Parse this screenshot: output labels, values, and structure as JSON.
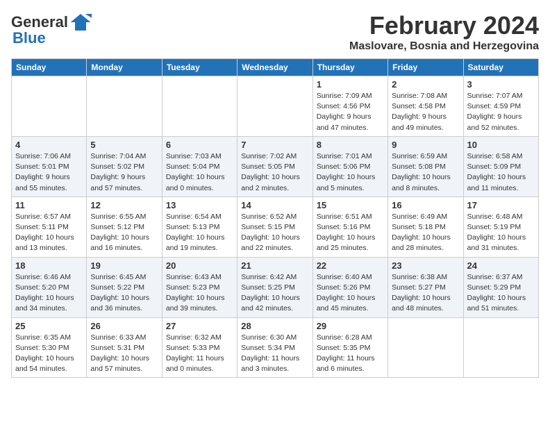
{
  "header": {
    "logo": {
      "general": "General",
      "blue": "Blue"
    },
    "month_title": "February 2024",
    "subtitle": "Maslovare, Bosnia and Herzegovina"
  },
  "days_of_week": [
    "Sunday",
    "Monday",
    "Tuesday",
    "Wednesday",
    "Thursday",
    "Friday",
    "Saturday"
  ],
  "weeks": [
    [
      {
        "day": "",
        "info": ""
      },
      {
        "day": "",
        "info": ""
      },
      {
        "day": "",
        "info": ""
      },
      {
        "day": "",
        "info": ""
      },
      {
        "day": "1",
        "info": "Sunrise: 7:09 AM\nSunset: 4:56 PM\nDaylight: 9 hours\nand 47 minutes."
      },
      {
        "day": "2",
        "info": "Sunrise: 7:08 AM\nSunset: 4:58 PM\nDaylight: 9 hours\nand 49 minutes."
      },
      {
        "day": "3",
        "info": "Sunrise: 7:07 AM\nSunset: 4:59 PM\nDaylight: 9 hours\nand 52 minutes."
      }
    ],
    [
      {
        "day": "4",
        "info": "Sunrise: 7:06 AM\nSunset: 5:01 PM\nDaylight: 9 hours\nand 55 minutes."
      },
      {
        "day": "5",
        "info": "Sunrise: 7:04 AM\nSunset: 5:02 PM\nDaylight: 9 hours\nand 57 minutes."
      },
      {
        "day": "6",
        "info": "Sunrise: 7:03 AM\nSunset: 5:04 PM\nDaylight: 10 hours\nand 0 minutes."
      },
      {
        "day": "7",
        "info": "Sunrise: 7:02 AM\nSunset: 5:05 PM\nDaylight: 10 hours\nand 2 minutes."
      },
      {
        "day": "8",
        "info": "Sunrise: 7:01 AM\nSunset: 5:06 PM\nDaylight: 10 hours\nand 5 minutes."
      },
      {
        "day": "9",
        "info": "Sunrise: 6:59 AM\nSunset: 5:08 PM\nDaylight: 10 hours\nand 8 minutes."
      },
      {
        "day": "10",
        "info": "Sunrise: 6:58 AM\nSunset: 5:09 PM\nDaylight: 10 hours\nand 11 minutes."
      }
    ],
    [
      {
        "day": "11",
        "info": "Sunrise: 6:57 AM\nSunset: 5:11 PM\nDaylight: 10 hours\nand 13 minutes."
      },
      {
        "day": "12",
        "info": "Sunrise: 6:55 AM\nSunset: 5:12 PM\nDaylight: 10 hours\nand 16 minutes."
      },
      {
        "day": "13",
        "info": "Sunrise: 6:54 AM\nSunset: 5:13 PM\nDaylight: 10 hours\nand 19 minutes."
      },
      {
        "day": "14",
        "info": "Sunrise: 6:52 AM\nSunset: 5:15 PM\nDaylight: 10 hours\nand 22 minutes."
      },
      {
        "day": "15",
        "info": "Sunrise: 6:51 AM\nSunset: 5:16 PM\nDaylight: 10 hours\nand 25 minutes."
      },
      {
        "day": "16",
        "info": "Sunrise: 6:49 AM\nSunset: 5:18 PM\nDaylight: 10 hours\nand 28 minutes."
      },
      {
        "day": "17",
        "info": "Sunrise: 6:48 AM\nSunset: 5:19 PM\nDaylight: 10 hours\nand 31 minutes."
      }
    ],
    [
      {
        "day": "18",
        "info": "Sunrise: 6:46 AM\nSunset: 5:20 PM\nDaylight: 10 hours\nand 34 minutes."
      },
      {
        "day": "19",
        "info": "Sunrise: 6:45 AM\nSunset: 5:22 PM\nDaylight: 10 hours\nand 36 minutes."
      },
      {
        "day": "20",
        "info": "Sunrise: 6:43 AM\nSunset: 5:23 PM\nDaylight: 10 hours\nand 39 minutes."
      },
      {
        "day": "21",
        "info": "Sunrise: 6:42 AM\nSunset: 5:25 PM\nDaylight: 10 hours\nand 42 minutes."
      },
      {
        "day": "22",
        "info": "Sunrise: 6:40 AM\nSunset: 5:26 PM\nDaylight: 10 hours\nand 45 minutes."
      },
      {
        "day": "23",
        "info": "Sunrise: 6:38 AM\nSunset: 5:27 PM\nDaylight: 10 hours\nand 48 minutes."
      },
      {
        "day": "24",
        "info": "Sunrise: 6:37 AM\nSunset: 5:29 PM\nDaylight: 10 hours\nand 51 minutes."
      }
    ],
    [
      {
        "day": "25",
        "info": "Sunrise: 6:35 AM\nSunset: 5:30 PM\nDaylight: 10 hours\nand 54 minutes."
      },
      {
        "day": "26",
        "info": "Sunrise: 6:33 AM\nSunset: 5:31 PM\nDaylight: 10 hours\nand 57 minutes."
      },
      {
        "day": "27",
        "info": "Sunrise: 6:32 AM\nSunset: 5:33 PM\nDaylight: 11 hours\nand 0 minutes."
      },
      {
        "day": "28",
        "info": "Sunrise: 6:30 AM\nSunset: 5:34 PM\nDaylight: 11 hours\nand 3 minutes."
      },
      {
        "day": "29",
        "info": "Sunrise: 6:28 AM\nSunset: 5:35 PM\nDaylight: 11 hours\nand 6 minutes."
      },
      {
        "day": "",
        "info": ""
      },
      {
        "day": "",
        "info": ""
      }
    ]
  ]
}
